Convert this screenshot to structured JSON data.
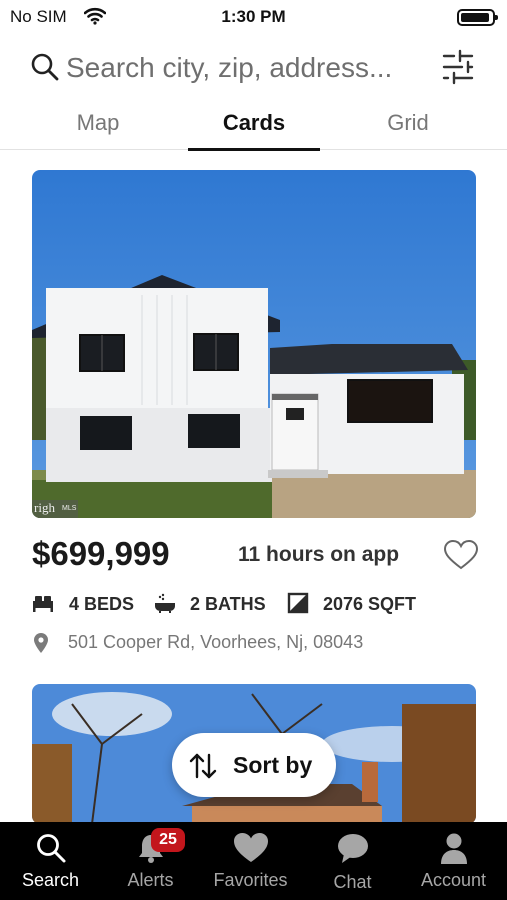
{
  "status_bar": {
    "carrier": "No SIM",
    "time": "1:30 PM",
    "battery_level": 0.92
  },
  "search": {
    "placeholder": "Search city, zip, address...",
    "value": ""
  },
  "view_tabs": {
    "items": [
      "Map",
      "Cards",
      "Grid"
    ],
    "active": "Cards"
  },
  "listing": {
    "price": "$699,999",
    "time_on_app": "11 hours on app",
    "beds": "4 BEDS",
    "baths": "2 BATHS",
    "sqft": "2076 SQFT",
    "address": "501 Cooper Rd, Voorhees, Nj, 08043",
    "photo_watermark": "righ",
    "photo_watermark_small": "MLS"
  },
  "sort_button": {
    "label": "Sort by"
  },
  "tab_bar": {
    "items": [
      {
        "label": "Search",
        "icon": "search-icon",
        "active": true
      },
      {
        "label": "Alerts",
        "icon": "bell-icon",
        "badge": "25"
      },
      {
        "label": "Favorites",
        "icon": "heart-icon"
      },
      {
        "label": "Chat",
        "icon": "chat-bubble-icon"
      },
      {
        "label": "Account",
        "icon": "person-icon"
      }
    ]
  },
  "colors": {
    "tab_bar_bg": "#000000",
    "badge": "#c3161c",
    "sky": "#3b7fd4"
  }
}
